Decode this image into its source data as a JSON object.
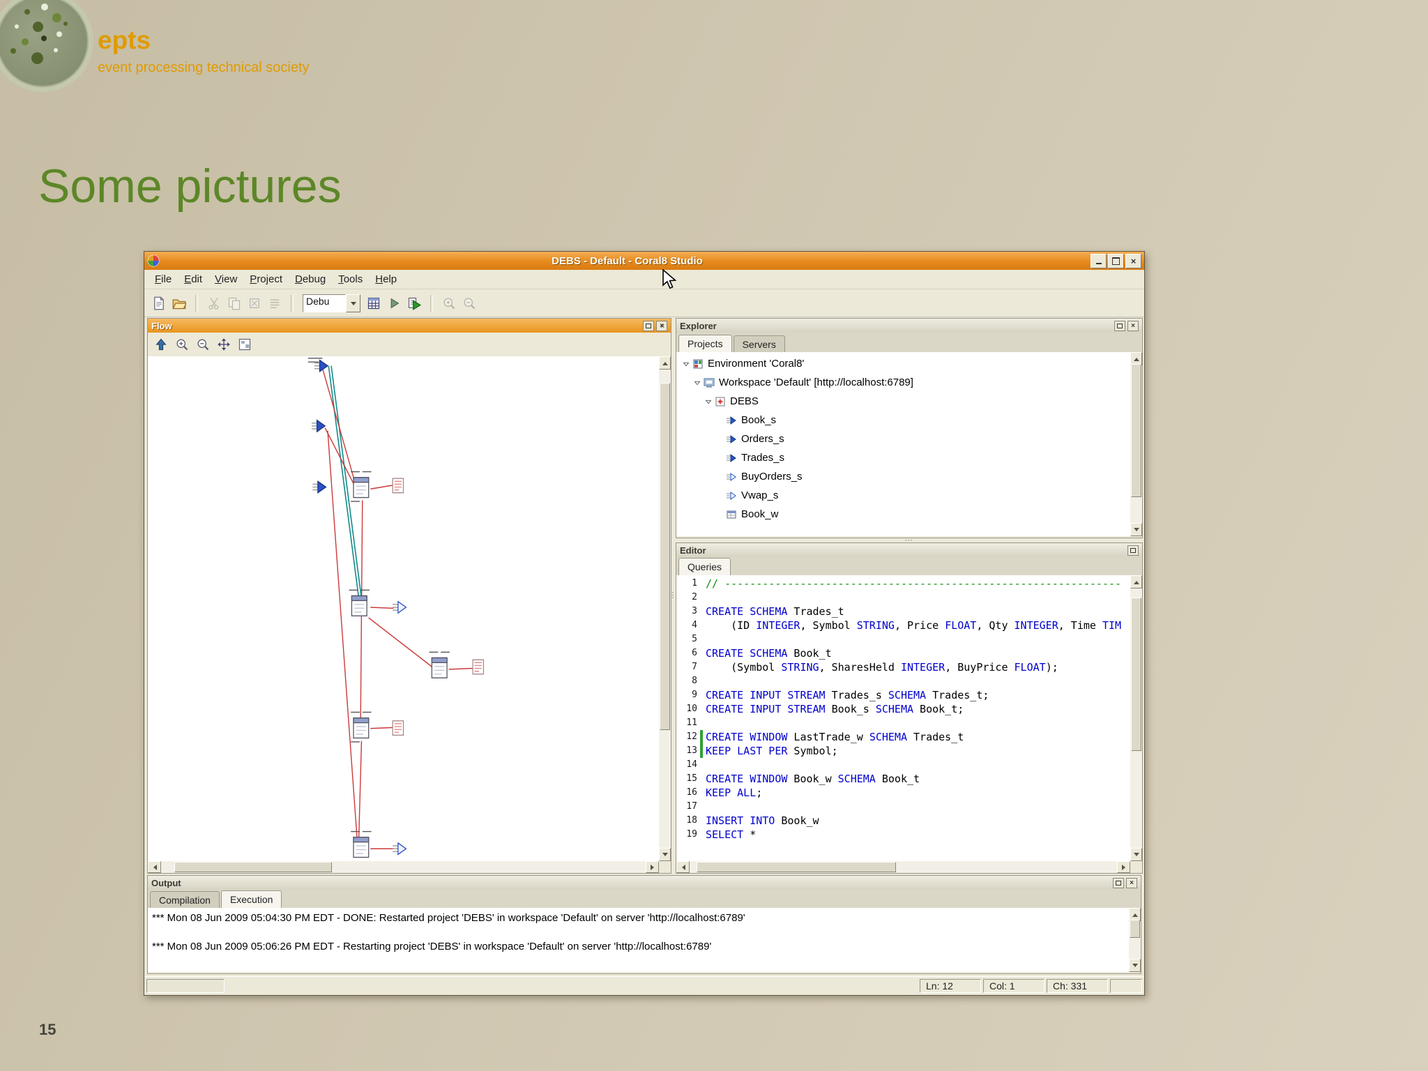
{
  "slide": {
    "logo_text": "epts",
    "logo_tagline": "event processing technical society",
    "title": "Some pictures",
    "page_number": "15"
  },
  "app": {
    "title": "DEBS - Default - Coral8 Studio",
    "menus": [
      "File",
      "Edit",
      "View",
      "Project",
      "Debug",
      "Tools",
      "Help"
    ],
    "toolbar": {
      "mode_value": "Debu"
    },
    "panels": {
      "flow": {
        "title": "Flow"
      },
      "explorer": {
        "title": "Explorer",
        "tabs": [
          "Projects",
          "Servers"
        ],
        "active_tab": "Projects",
        "tree": [
          {
            "label": "Environment 'Coral8'",
            "level": 0,
            "expanded": true,
            "icon": "environment"
          },
          {
            "label": "Workspace 'Default' [http://localhost:6789]",
            "level": 1,
            "expanded": true,
            "icon": "workspace"
          },
          {
            "label": "DEBS",
            "level": 2,
            "expanded": true,
            "icon": "project"
          },
          {
            "label": "Book_s",
            "level": 3,
            "icon": "stream-filled"
          },
          {
            "label": "Orders_s",
            "level": 3,
            "icon": "stream-filled"
          },
          {
            "label": "Trades_s",
            "level": 3,
            "icon": "stream-filled"
          },
          {
            "label": "BuyOrders_s",
            "level": 3,
            "icon": "stream-outline"
          },
          {
            "label": "Vwap_s",
            "level": 3,
            "icon": "stream-outline"
          },
          {
            "label": "Book_w",
            "level": 3,
            "icon": "window"
          }
        ]
      },
      "editor": {
        "title": "Editor",
        "tabs": [
          "Queries"
        ],
        "active_tab": "Queries",
        "code": [
          {
            "n": 1,
            "t": [
              [
                "c",
                "// ---------------------------------------------------------------"
              ]
            ]
          },
          {
            "n": 2,
            "t": []
          },
          {
            "n": 3,
            "t": [
              [
                "k",
                "CREATE SCHEMA"
              ],
              [
                "p",
                " Trades_t"
              ]
            ]
          },
          {
            "n": 4,
            "t": [
              [
                "p",
                "    (ID "
              ],
              [
                "k",
                "INTEGER"
              ],
              [
                "p",
                ", Symbol "
              ],
              [
                "k",
                "STRING"
              ],
              [
                "p",
                ", Price "
              ],
              [
                "k",
                "FLOAT"
              ],
              [
                "p",
                ", Qty "
              ],
              [
                "k",
                "INTEGER"
              ],
              [
                "p",
                ", Time "
              ],
              [
                "k",
                "TIM"
              ]
            ]
          },
          {
            "n": 5,
            "t": []
          },
          {
            "n": 6,
            "t": [
              [
                "k",
                "CREATE SCHEMA"
              ],
              [
                "p",
                " Book_t"
              ]
            ]
          },
          {
            "n": 7,
            "t": [
              [
                "p",
                "    (Symbol "
              ],
              [
                "k",
                "STRING"
              ],
              [
                "p",
                ", SharesHeld "
              ],
              [
                "k",
                "INTEGER"
              ],
              [
                "p",
                ", BuyPrice "
              ],
              [
                "k",
                "FLOAT"
              ],
              [
                "p",
                ");"
              ]
            ]
          },
          {
            "n": 8,
            "t": []
          },
          {
            "n": 9,
            "t": [
              [
                "k",
                "CREATE INPUT STREAM"
              ],
              [
                "p",
                " Trades_s "
              ],
              [
                "k",
                "SCHEMA"
              ],
              [
                "p",
                " Trades_t;"
              ]
            ]
          },
          {
            "n": 10,
            "t": [
              [
                "k",
                "CREATE INPUT STREAM"
              ],
              [
                "p",
                " Book_s "
              ],
              [
                "k",
                "SCHEMA"
              ],
              [
                "p",
                " Book_t;"
              ]
            ]
          },
          {
            "n": 11,
            "t": []
          },
          {
            "n": 12,
            "chg": true,
            "t": [
              [
                "k",
                "CREATE WINDOW"
              ],
              [
                "p",
                " LastTrade_w "
              ],
              [
                "k",
                "SCHEMA"
              ],
              [
                "p",
                " Trades_t"
              ]
            ]
          },
          {
            "n": 13,
            "chg": true,
            "t": [
              [
                "k",
                "KEEP LAST PER"
              ],
              [
                "p",
                " Symbol;"
              ]
            ]
          },
          {
            "n": 14,
            "t": []
          },
          {
            "n": 15,
            "t": [
              [
                "k",
                "CREATE WINDOW"
              ],
              [
                "p",
                " Book_w "
              ],
              [
                "k",
                "SCHEMA"
              ],
              [
                "p",
                " Book_t"
              ]
            ]
          },
          {
            "n": 16,
            "t": [
              [
                "k",
                "KEEP ALL"
              ],
              [
                "p",
                ";"
              ]
            ]
          },
          {
            "n": 17,
            "t": []
          },
          {
            "n": 18,
            "t": [
              [
                "k",
                "INSERT INTO"
              ],
              [
                "p",
                " Book_w"
              ]
            ]
          },
          {
            "n": 19,
            "t": [
              [
                "k",
                "SELECT"
              ],
              [
                "p",
                " *"
              ]
            ]
          }
        ]
      },
      "output": {
        "title": "Output",
        "tabs": [
          "Compilation",
          "Execution"
        ],
        "active_tab": "Execution",
        "lines": [
          "*** Mon 08 Jun 2009 05:04:30 PM EDT - DONE: Restarted project 'DEBS' in workspace 'Default' on server 'http://localhost:6789'",
          "*** Mon 08 Jun 2009 05:06:26 PM EDT - Restarting project 'DEBS' in workspace 'Default' on server 'http://localhost:6789'"
        ]
      }
    },
    "statusbar": {
      "ln": "Ln: 12",
      "col": "Col: 1",
      "ch": "Ch: 331"
    }
  }
}
